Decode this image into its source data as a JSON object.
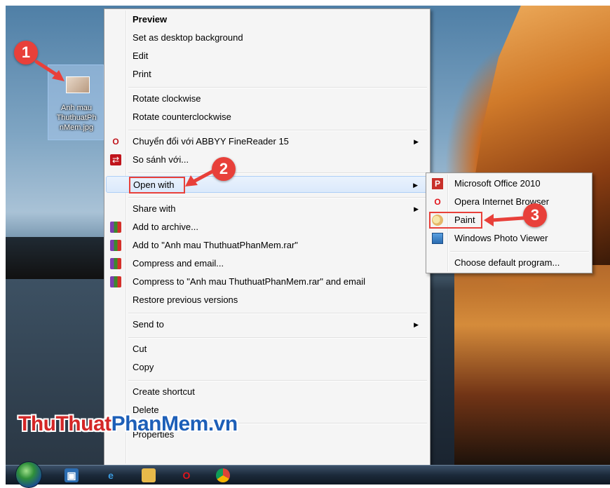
{
  "desktop_file": {
    "name_lines": [
      "Anh mau",
      "ThuthuatPh",
      "nMem.jpg"
    ]
  },
  "badges": [
    "1",
    "2",
    "3"
  ],
  "context_menu": {
    "groups": [
      [
        {
          "label": "Preview",
          "bold": true
        },
        {
          "label": "Set as desktop background"
        },
        {
          "label": "Edit"
        },
        {
          "label": "Print"
        }
      ],
      [
        {
          "label": "Rotate clockwise"
        },
        {
          "label": "Rotate counterclockwise"
        }
      ],
      [
        {
          "label": "Chuyển đổi với ABBYY FineReader 15",
          "icon": "abbyy-icon",
          "submenu": true
        },
        {
          "label": "So sánh với...",
          "icon": "compare-icon"
        }
      ],
      [
        {
          "label": "Open with",
          "submenu": true,
          "highlighted": true
        }
      ],
      [
        {
          "label": "Share with",
          "submenu": true
        },
        {
          "label": "Add to archive...",
          "icon": "winrar-icon"
        },
        {
          "label": "Add to \"Anh mau ThuthuatPhanMem.rar\"",
          "icon": "winrar-icon"
        },
        {
          "label": "Compress and email...",
          "icon": "winrar-icon"
        },
        {
          "label": "Compress to \"Anh mau ThuthuatPhanMem.rar\" and email",
          "icon": "winrar-icon"
        },
        {
          "label": "Restore previous versions"
        }
      ],
      [
        {
          "label": "Send to",
          "submenu": true
        }
      ],
      [
        {
          "label": "Cut"
        },
        {
          "label": "Copy"
        }
      ],
      [
        {
          "label": "Create shortcut"
        },
        {
          "label": "Delete"
        }
      ],
      [
        {
          "label": "Properties"
        }
      ]
    ]
  },
  "open_with_menu": {
    "items": [
      {
        "label": "Microsoft Office 2010",
        "icon": "office-icon"
      },
      {
        "label": "Opera Internet Browser",
        "icon": "opera-icon"
      },
      {
        "label": "Paint",
        "icon": "paint-icon",
        "boxed": true
      },
      {
        "label": "Windows Photo Viewer",
        "icon": "photo-viewer-icon"
      }
    ],
    "footer": "Choose default program..."
  },
  "watermark": {
    "part1": "ThuThuat",
    "part2": "PhanMem.vn"
  },
  "taskbar": {
    "icons": [
      "windows-explorer-icon",
      "internet-explorer-icon",
      "folder-icon",
      "opera-icon",
      "chrome-icon"
    ]
  },
  "colors": {
    "annotation_red": "#e8403a",
    "menu_bg": "#f5f5f5",
    "highlight": "#dbe9fb"
  }
}
